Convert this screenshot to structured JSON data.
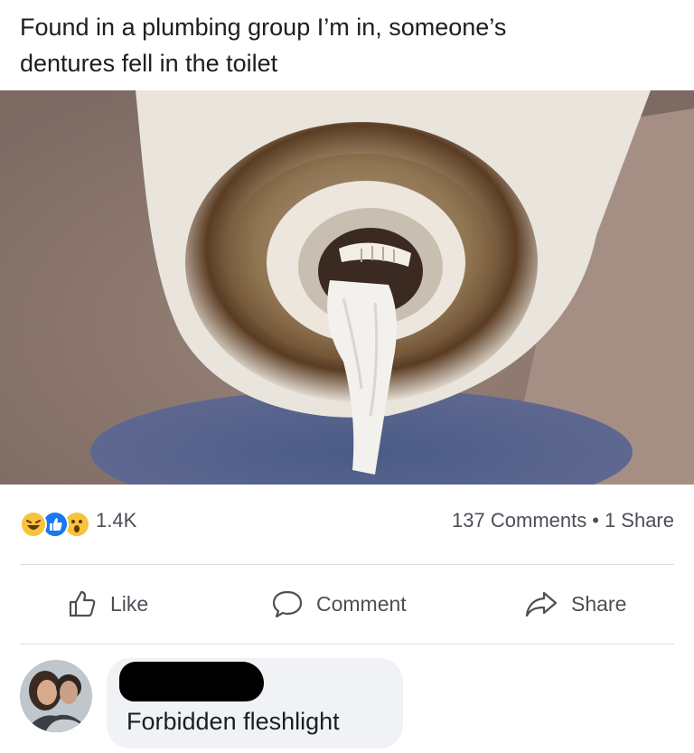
{
  "post": {
    "text_line1": "Found in a plumbing group I’m in, someone’s",
    "text_line2": "dentures fell in the toilet"
  },
  "photo": {
    "subject": "toilet-drain-with-dentures"
  },
  "stats": {
    "reactions": [
      "haha",
      "like",
      "wow"
    ],
    "reaction_count": "1.4K",
    "comments": "137 Comments",
    "separator": "•",
    "shares": "1 Share"
  },
  "actions": {
    "like_label": "Like",
    "comment_label": "Comment",
    "share_label": "Share"
  },
  "comment": {
    "author_redacted": true,
    "text": "Forbidden fleshlight"
  },
  "colors": {
    "like_blue": "#1877f2",
    "reaction_yellow": "#f7c33d",
    "secondary_text": "#4b4f56",
    "bubble_bg": "#f0f2f5"
  }
}
